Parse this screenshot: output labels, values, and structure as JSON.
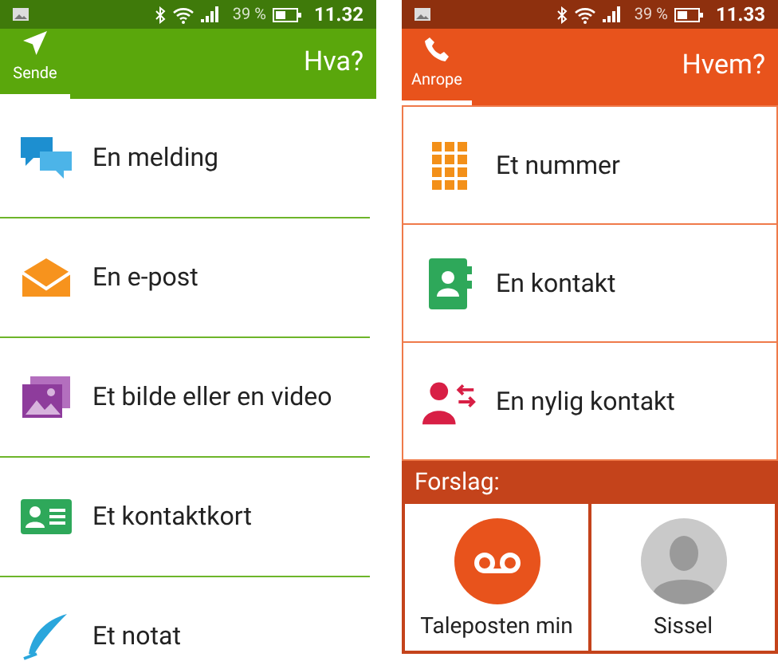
{
  "screens": [
    {
      "kind": "send",
      "status": {
        "battery": "39 %",
        "time": "11.32"
      },
      "tab": {
        "label": "Sende",
        "selected": true
      },
      "title": "Hva?",
      "items": [
        {
          "kind": "chat",
          "label": "En melding"
        },
        {
          "kind": "mail",
          "label": "En e-post"
        },
        {
          "kind": "photo",
          "label": "Et bilde eller en video"
        },
        {
          "kind": "card",
          "label": "Et kontaktkort"
        },
        {
          "kind": "feather",
          "label": "Et notat"
        }
      ]
    },
    {
      "kind": "call",
      "status": {
        "battery": "39 %",
        "time": "11.33"
      },
      "tab": {
        "label": "Anrope",
        "selected": true
      },
      "title": "Hvem?",
      "items": [
        {
          "kind": "keypad",
          "label": "Et nummer"
        },
        {
          "kind": "book",
          "label": "En kontakt"
        },
        {
          "kind": "recent",
          "label": "En nylig kontakt"
        }
      ],
      "suggestions": {
        "heading": "Forslag:",
        "tiles": [
          {
            "kind": "voicemail",
            "label": "Taleposten min"
          },
          {
            "kind": "avatar",
            "label": "Sissel"
          }
        ]
      }
    }
  ]
}
